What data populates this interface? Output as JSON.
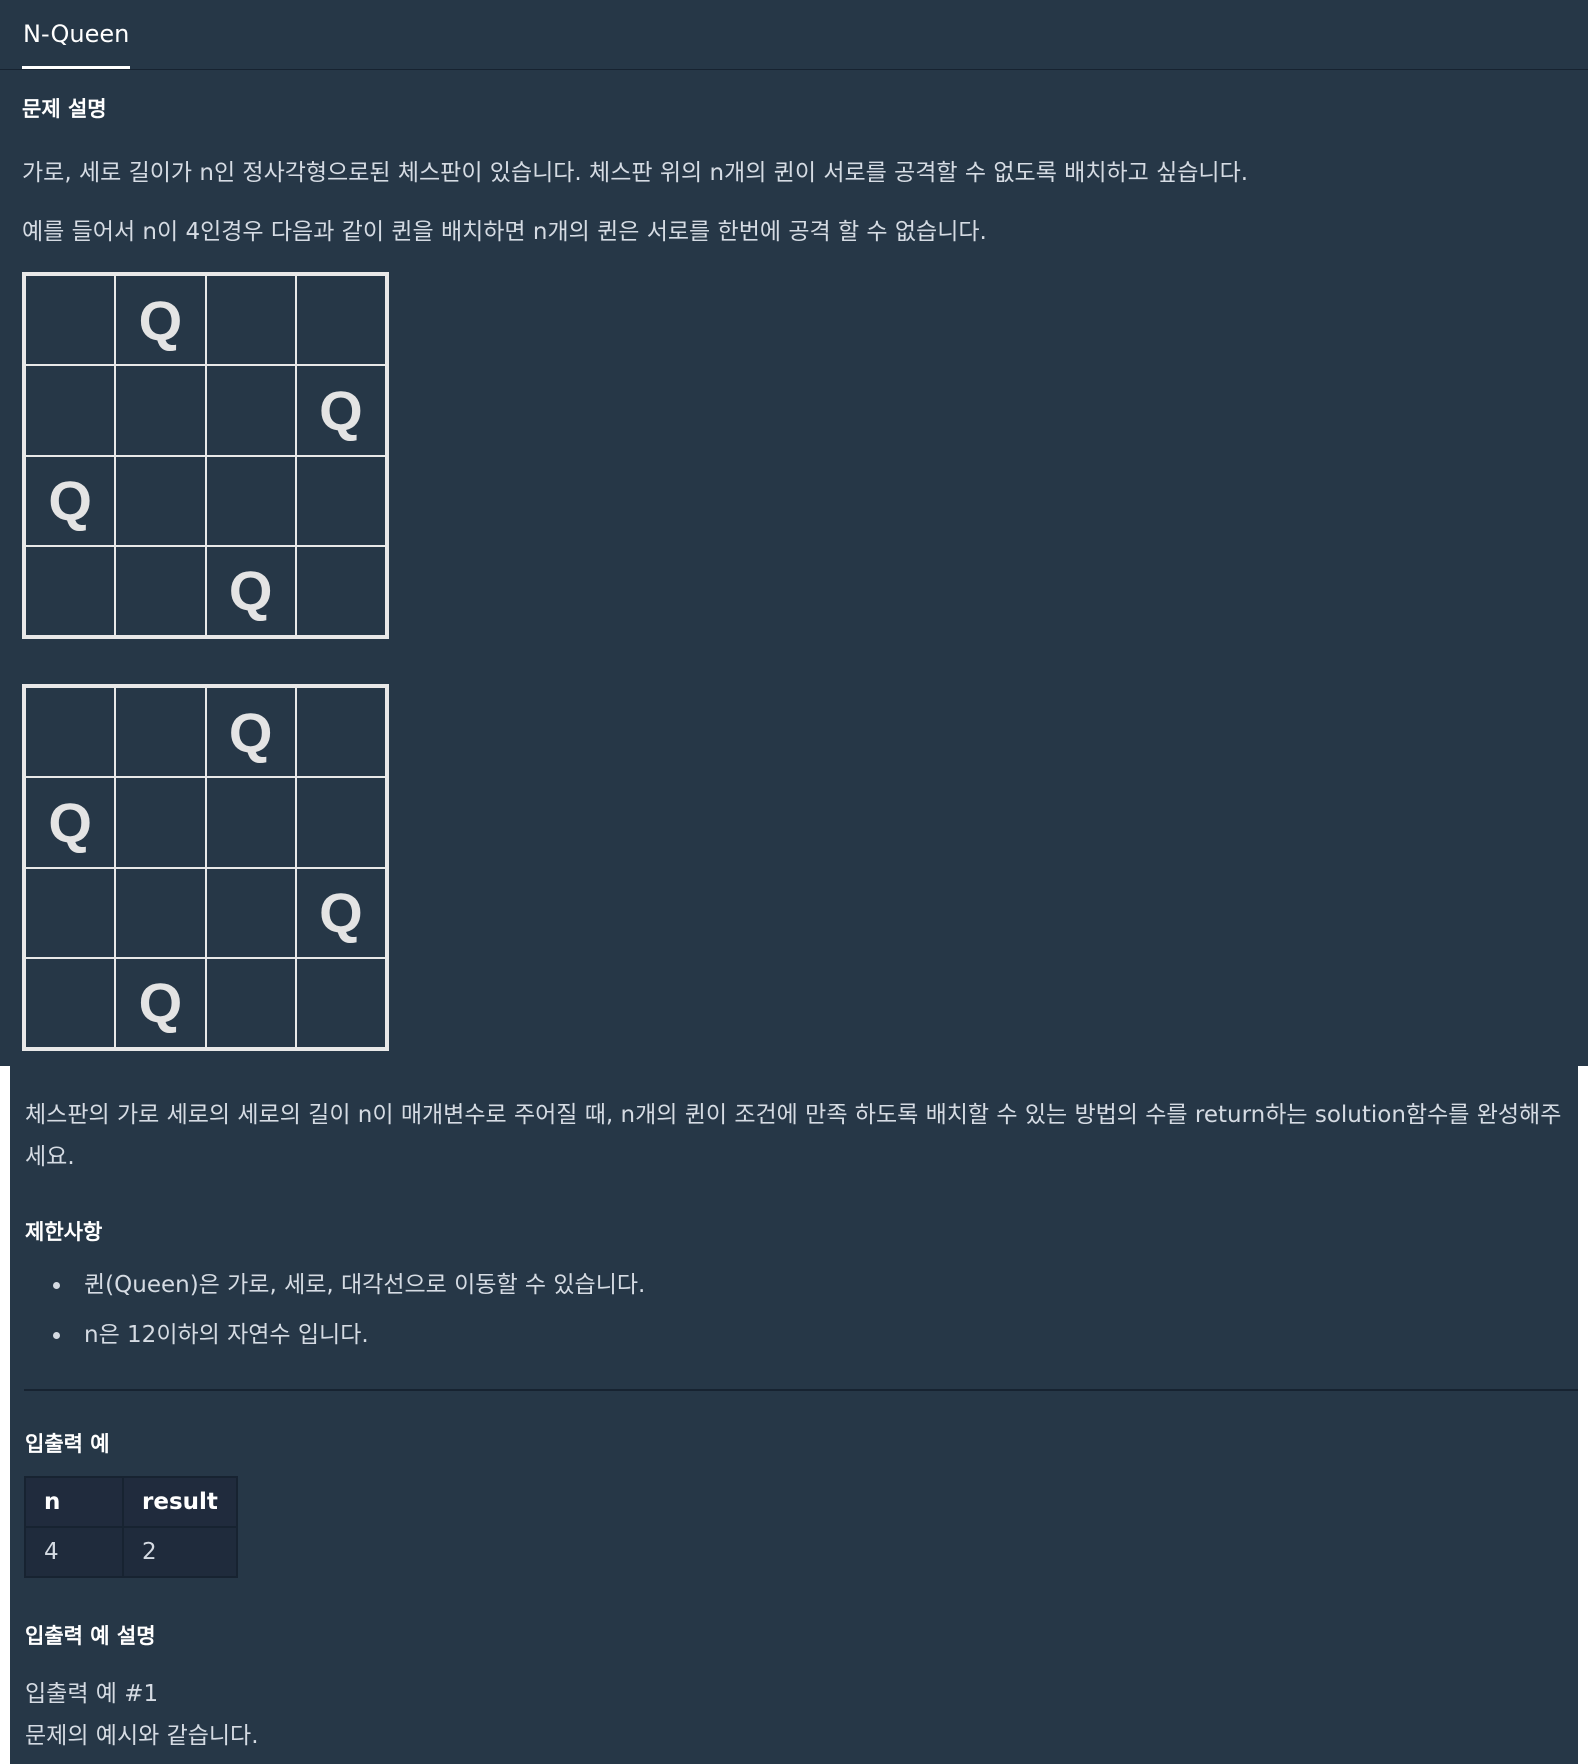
{
  "tab": {
    "title": "N-Queen"
  },
  "description": {
    "heading": "문제 설명",
    "para1": "가로, 세로 길이가 n인 정사각형으로된 체스판이 있습니다. 체스판 위의 n개의 퀸이 서로를 공격할 수 없도록 배치하고 싶습니다.",
    "para2": "예를 들어서 n이 4인경우 다음과 같이 퀸을 배치하면 n개의 퀸은 서로를 한번에 공격 할 수 없습니다.",
    "para3": "체스판의 가로 세로의 세로의 길이 n이 매개변수로 주어질 때, n개의 퀸이 조건에 만족 하도록 배치할 수 있는 방법의 수를 return하는 solution함수를 완성해주세요."
  },
  "boards": [
    {
      "queen_columns": [
        1,
        3,
        0,
        2
      ],
      "piece": "Q"
    },
    {
      "queen_columns": [
        2,
        0,
        3,
        1
      ],
      "piece": "Q"
    }
  ],
  "constraints": {
    "heading": "제한사항",
    "items": [
      "퀸(Queen)은 가로, 세로, 대각선으로 이동할 수 있습니다.",
      "n은 12이하의 자연수 입니다."
    ]
  },
  "io_example": {
    "heading": "입출력 예",
    "headers": [
      "n",
      "result"
    ],
    "rows": [
      [
        "4",
        "2"
      ]
    ]
  },
  "io_explanation": {
    "heading": "입출력 예 설명",
    "line1": "입출력 예 #1",
    "line2": "문제의 예시와 같습니다."
  }
}
